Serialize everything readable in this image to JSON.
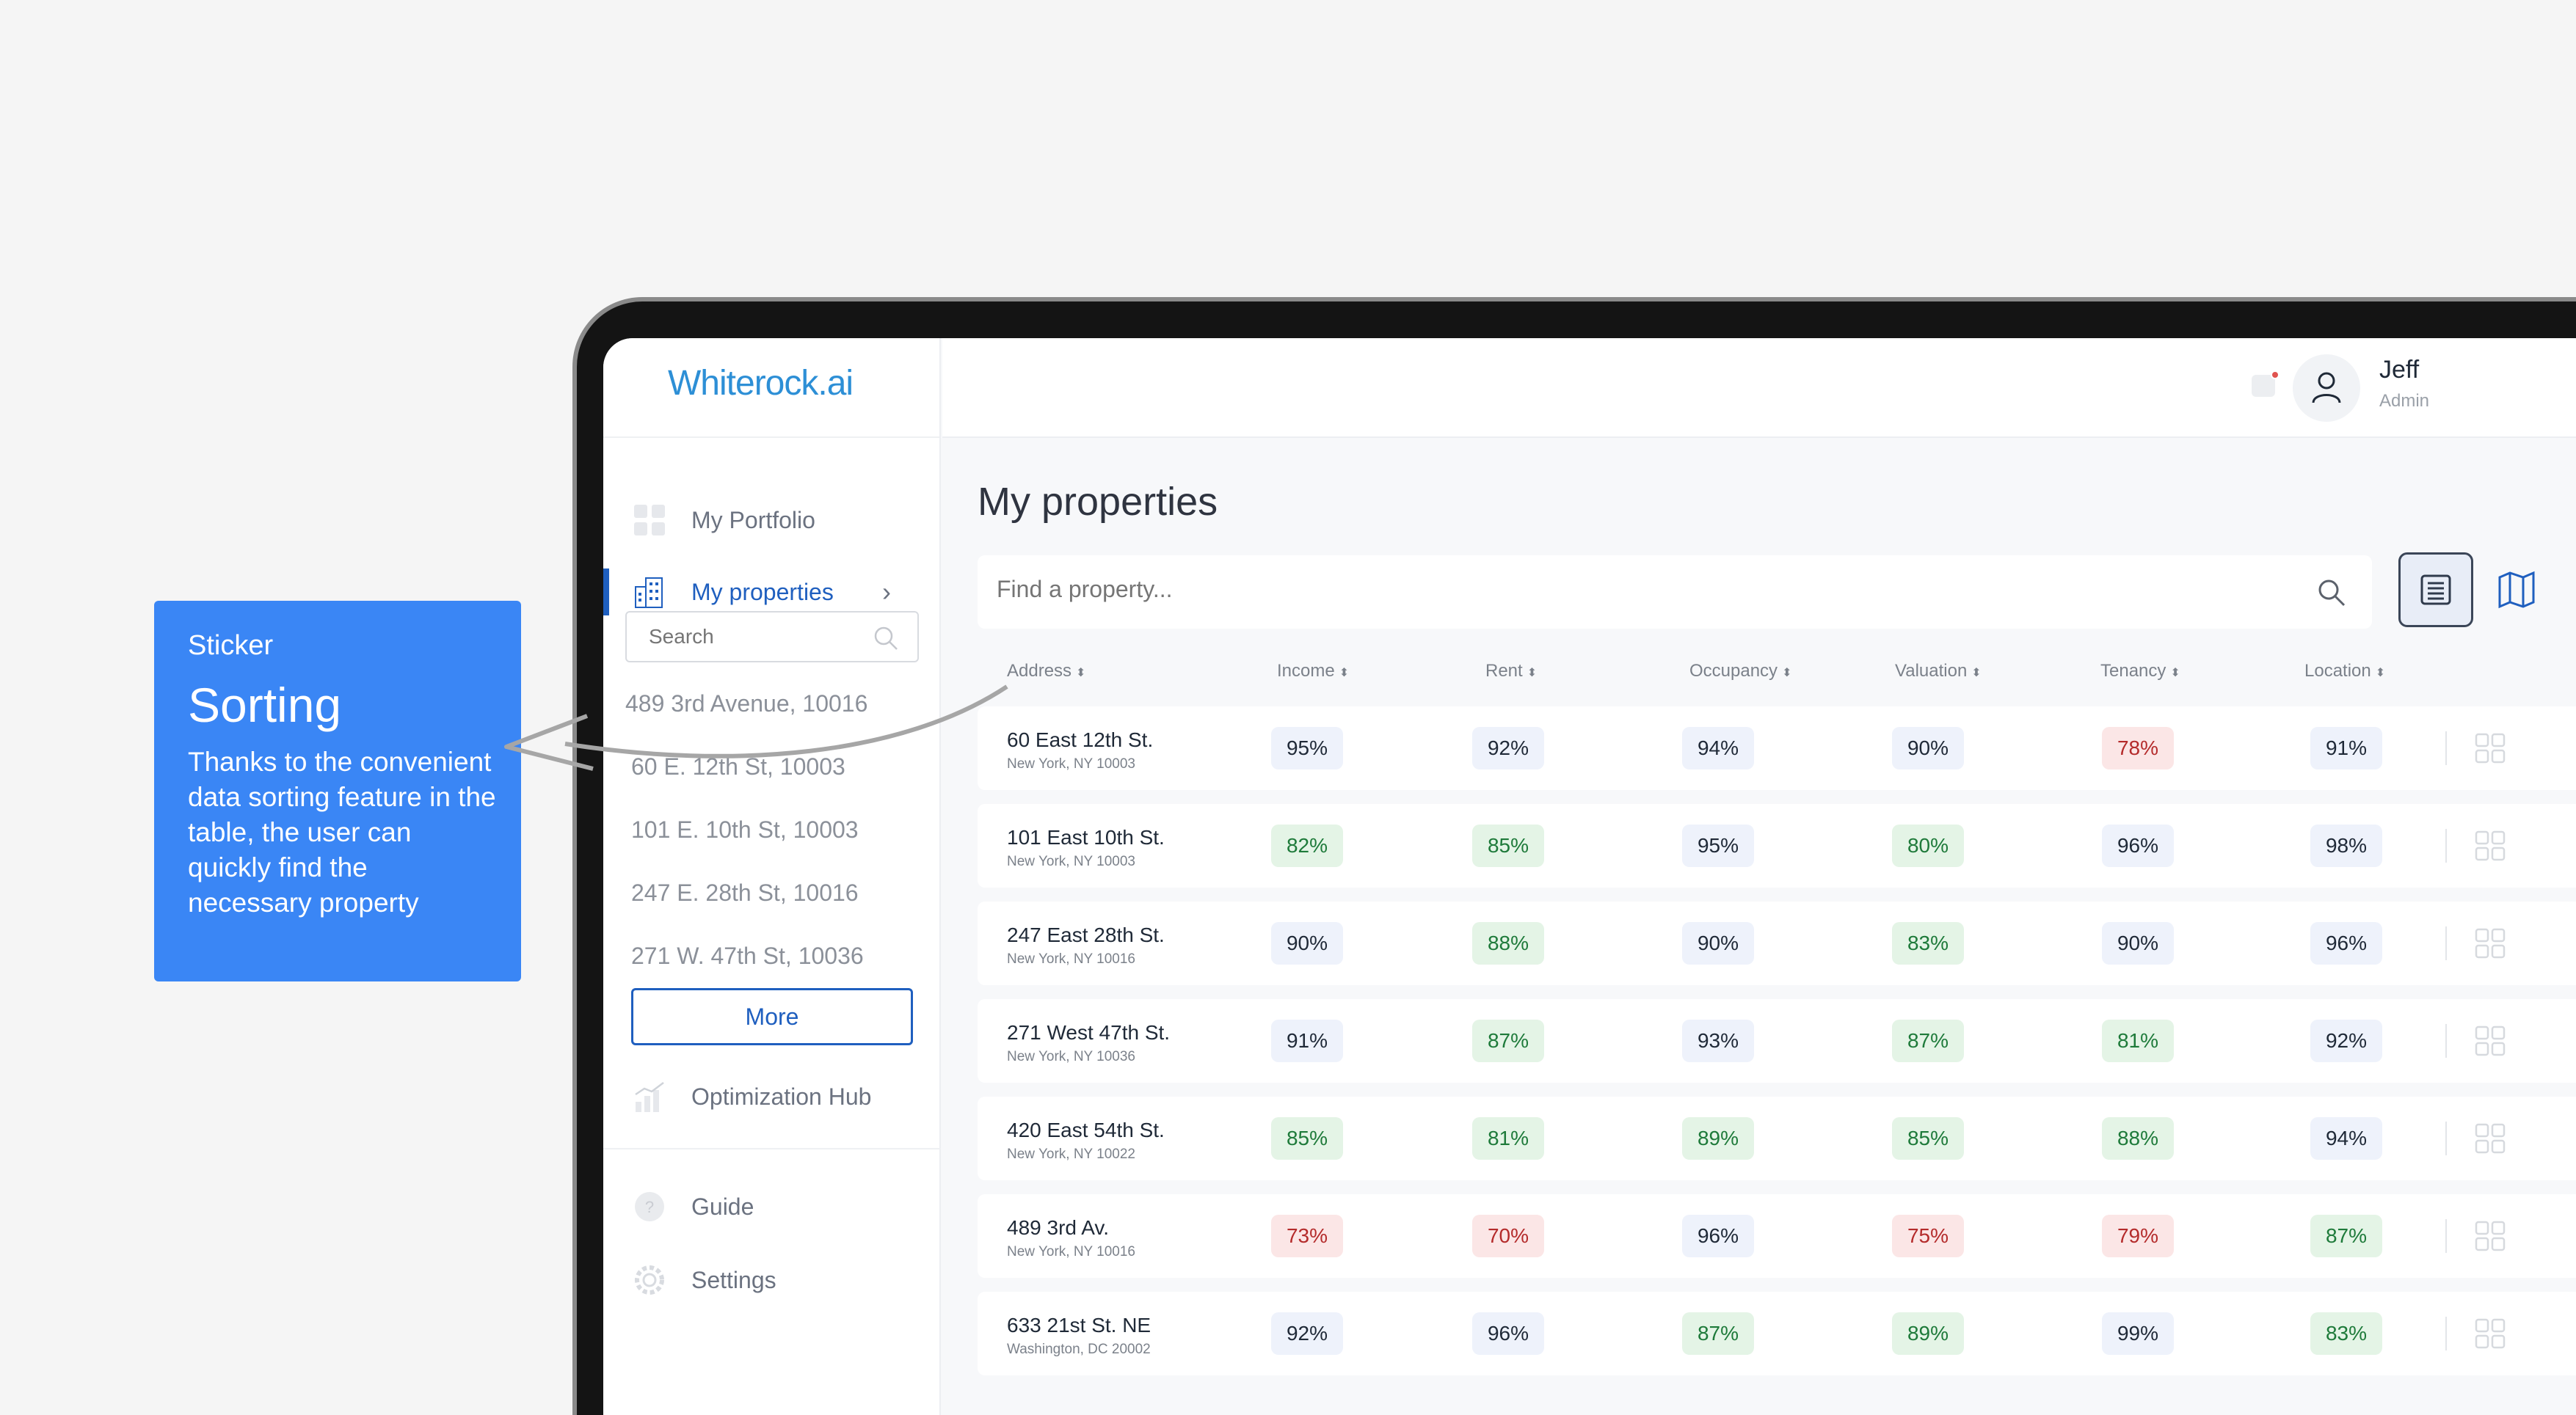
{
  "sticker": {
    "kicker": "Sticker",
    "title": "Sorting",
    "description": "Thanks to the convenient data sorting feature in the table, the user can quickly find the necessary property",
    "color": "#3a86f5"
  },
  "app": {
    "logo": "Whiterock.ai",
    "accent": "#1f5fbf"
  },
  "sidebar": {
    "items": [
      {
        "label": "My Portfolio",
        "icon": "grid-icon"
      },
      {
        "label": "My properties",
        "icon": "building-icon"
      },
      {
        "label": "Optimization Hub",
        "icon": "chart-icon"
      },
      {
        "label": "Guide",
        "icon": "help-icon"
      },
      {
        "label": "Settings",
        "icon": "gear-icon"
      }
    ],
    "search_placeholder": "Search",
    "addresses": [
      "489 3rd Avenue, 10016",
      "60 E. 12th St, 10003",
      "101 E. 10th St, 10003",
      "247 E. 28th St, 10016",
      "271 W. 47th St, 10036"
    ],
    "more_label": "More"
  },
  "header": {
    "user_name": "Jeff",
    "user_role": "Admin"
  },
  "main": {
    "title": "My properties",
    "find_placeholder": "Find a property...",
    "columns": [
      "Address",
      "Income",
      "Rent",
      "Occupancy",
      "Valuation",
      "Tenancy",
      "Location"
    ],
    "rows": [
      {
        "street": "60 East 12th St.",
        "city": "New York, NY 10003",
        "scores": [
          [
            "95%",
            "blue"
          ],
          [
            "92%",
            "blue"
          ],
          [
            "94%",
            "blue"
          ],
          [
            "90%",
            "blue"
          ],
          [
            "78%",
            "red"
          ],
          [
            "91%",
            "blue"
          ]
        ]
      },
      {
        "street": "101 East 10th St.",
        "city": "New York, NY 10003",
        "scores": [
          [
            "82%",
            "green"
          ],
          [
            "85%",
            "green"
          ],
          [
            "95%",
            "blue"
          ],
          [
            "80%",
            "green"
          ],
          [
            "96%",
            "blue"
          ],
          [
            "98%",
            "blue"
          ]
        ]
      },
      {
        "street": "247 East 28th St.",
        "city": "New York, NY 10016",
        "scores": [
          [
            "90%",
            "blue"
          ],
          [
            "88%",
            "green"
          ],
          [
            "90%",
            "blue"
          ],
          [
            "83%",
            "green"
          ],
          [
            "90%",
            "blue"
          ],
          [
            "96%",
            "blue"
          ]
        ]
      },
      {
        "street": "271 West 47th St.",
        "city": "New York, NY 10036",
        "scores": [
          [
            "91%",
            "blue"
          ],
          [
            "87%",
            "green"
          ],
          [
            "93%",
            "blue"
          ],
          [
            "87%",
            "green"
          ],
          [
            "81%",
            "green"
          ],
          [
            "92%",
            "blue"
          ]
        ]
      },
      {
        "street": "420 East 54th St.",
        "city": "New York, NY 10022",
        "scores": [
          [
            "85%",
            "green"
          ],
          [
            "81%",
            "green"
          ],
          [
            "89%",
            "green"
          ],
          [
            "85%",
            "green"
          ],
          [
            "88%",
            "green"
          ],
          [
            "94%",
            "blue"
          ]
        ]
      },
      {
        "street": "489 3rd Av.",
        "city": "New York, NY 10016",
        "scores": [
          [
            "73%",
            "red"
          ],
          [
            "70%",
            "red"
          ],
          [
            "96%",
            "blue"
          ],
          [
            "75%",
            "red"
          ],
          [
            "79%",
            "red"
          ],
          [
            "87%",
            "green"
          ]
        ]
      },
      {
        "street": "633 21st St. NE",
        "city": "Washington, DC 20002",
        "scores": [
          [
            "92%",
            "blue"
          ],
          [
            "96%",
            "blue"
          ],
          [
            "87%",
            "green"
          ],
          [
            "89%",
            "green"
          ],
          [
            "99%",
            "blue"
          ],
          [
            "83%",
            "green"
          ]
        ]
      }
    ]
  }
}
